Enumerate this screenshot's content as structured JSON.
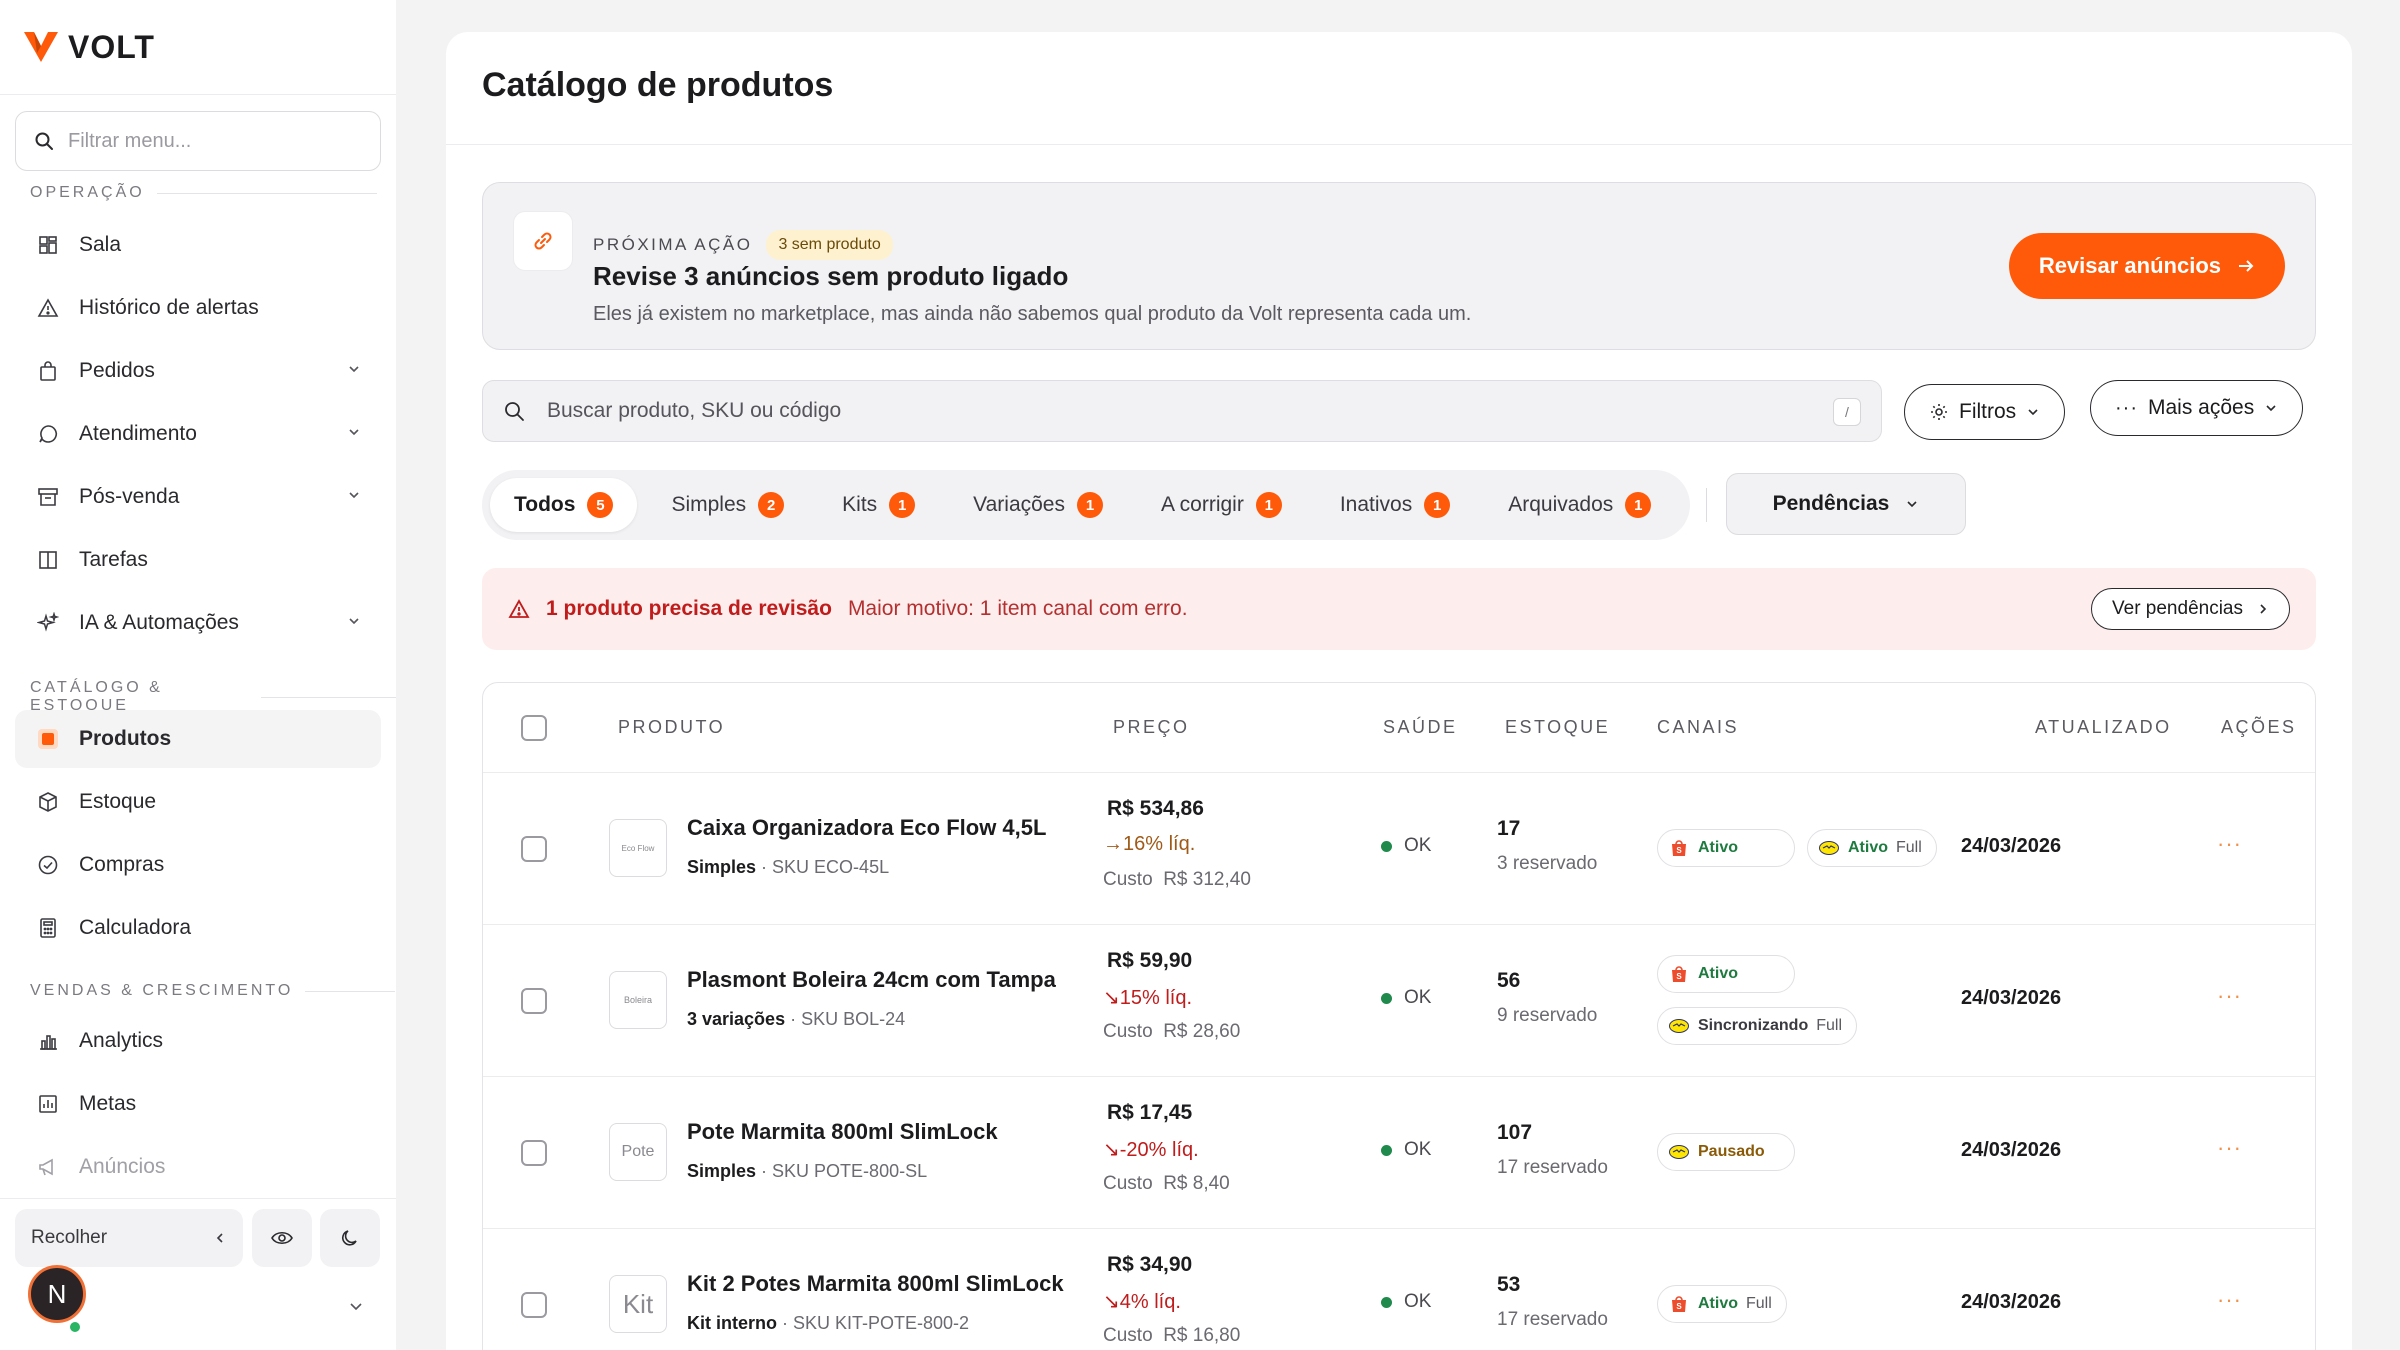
{
  "brand": {
    "name": "VOLT",
    "accent": "#ff5a0a"
  },
  "sidebar": {
    "filter_placeholder": "Filtrar menu...",
    "sections": [
      {
        "label": "OPERAÇÃO"
      },
      {
        "label": "CATÁLOGO & ESTOQUE"
      },
      {
        "label": "VENDAS & CRESCIMENTO"
      }
    ],
    "items": [
      {
        "label": "Sala",
        "icon": "grid-icon"
      },
      {
        "label": "Histórico de alertas",
        "icon": "warning-icon"
      },
      {
        "label": "Pedidos",
        "icon": "bag-icon"
      },
      {
        "label": "Atendimento",
        "icon": "chat-icon"
      },
      {
        "label": "Pós-venda",
        "icon": "archive-icon"
      },
      {
        "label": "Tarefas",
        "icon": "columns-icon"
      },
      {
        "label": "IA & Automações",
        "icon": "sparkle-icon"
      },
      {
        "label": "Produtos",
        "icon": "product-icon"
      },
      {
        "label": "Estoque",
        "icon": "box-icon"
      },
      {
        "label": "Compras",
        "icon": "check-circle-icon"
      },
      {
        "label": "Calculadora",
        "icon": "calculator-icon"
      },
      {
        "label": "Analytics",
        "icon": "bar-chart-icon"
      },
      {
        "label": "Metas",
        "icon": "chart-box-icon"
      },
      {
        "label": "Anúncios",
        "icon": "megaphone-icon"
      }
    ],
    "collapse_label": "Recolher",
    "user_initial": "N"
  },
  "page": {
    "title": "Catálogo de produtos"
  },
  "next_action": {
    "kicker": "PRÓXIMA AÇÃO",
    "badge": "3 sem produto",
    "title": "Revise 3 anúncios sem produto ligado",
    "description": "Eles já existem no marketplace, mas ainda não sabemos qual produto da Volt representa cada um.",
    "button": "Revisar anúncios"
  },
  "search": {
    "placeholder": "Buscar produto, SKU ou código",
    "shortcut": "/"
  },
  "toolbar": {
    "filters": "Filtros",
    "more_actions": "Mais ações"
  },
  "tabs": [
    {
      "label": "Todos",
      "count": "5"
    },
    {
      "label": "Simples",
      "count": "2"
    },
    {
      "label": "Kits",
      "count": "1"
    },
    {
      "label": "Variações",
      "count": "1"
    },
    {
      "label": "A corrigir",
      "count": "1"
    },
    {
      "label": "Inativos",
      "count": "1"
    },
    {
      "label": "Arquivados",
      "count": "1"
    }
  ],
  "pendencias": "Pendências",
  "alert": {
    "strong": "1 produto precisa de revisão",
    "text": "Maior motivo: 1 item canal com erro.",
    "button": "Ver pendências"
  },
  "table": {
    "headers": {
      "produto": "PRODUTO",
      "preco": "PREÇO",
      "saude": "SAÚDE",
      "estoque": "ESTOQUE",
      "canais": "CANAIS",
      "atualizado": "ATUALIZADO",
      "acoes": "AÇÕES"
    },
    "rows": [
      {
        "thumb": "Eco Flow",
        "name": "Caixa Organizadora Eco Flow 4,5L",
        "type": "Simples",
        "sku": "· SKU ECO-45L",
        "price": "R$ 534,86",
        "margin": "→16% líq.",
        "cost_label": "Custo",
        "cost": "R$ 312,40",
        "health": "OK",
        "stock": "17",
        "reserved": "3 reservado",
        "channels": [
          {
            "status": "Ativo",
            "full": ""
          },
          {
            "status": "Ativo",
            "full": "Full"
          }
        ],
        "updated": "24/03/2026",
        "more": "···"
      },
      {
        "thumb": "Boleira",
        "name": "Plasmont Boleira 24cm com Tampa",
        "type": "3 variações",
        "sku": "· SKU BOL-24",
        "price": "R$ 59,90",
        "margin": "↘15% líq.",
        "cost_label": "Custo",
        "cost": "R$ 28,60",
        "health": "OK",
        "stock": "56",
        "reserved": "9 reservado",
        "channels": [
          {
            "status": "Ativo",
            "full": ""
          },
          {
            "status": "Sincronizando",
            "full": "Full"
          }
        ],
        "updated": "24/03/2026",
        "more": "···"
      },
      {
        "thumb": "Pote",
        "name": "Pote Marmita 800ml SlimLock",
        "type": "Simples",
        "sku": "· SKU POTE-800-SL",
        "price": "R$ 17,45",
        "margin": "↘-20% líq.",
        "cost_label": "Custo",
        "cost": "R$ 8,40",
        "health": "OK",
        "stock": "107",
        "reserved": "17 reservado",
        "channels": [
          {
            "status": "Pausado",
            "full": ""
          }
        ],
        "updated": "24/03/2026",
        "more": "···"
      },
      {
        "thumb": "Kit",
        "name": "Kit 2 Potes Marmita 800ml SlimLock",
        "type": "Kit interno",
        "sku": "· SKU KIT-POTE-800-2",
        "price": "R$ 34,90",
        "margin": "↘4% líq.",
        "cost_label": "Custo",
        "cost": "R$ 16,80",
        "health": "OK",
        "stock": "53",
        "reserved": "17 reservado",
        "channels": [
          {
            "status": "Ativo",
            "full": "Full"
          }
        ],
        "updated": "24/03/2026",
        "more": "···"
      }
    ]
  }
}
